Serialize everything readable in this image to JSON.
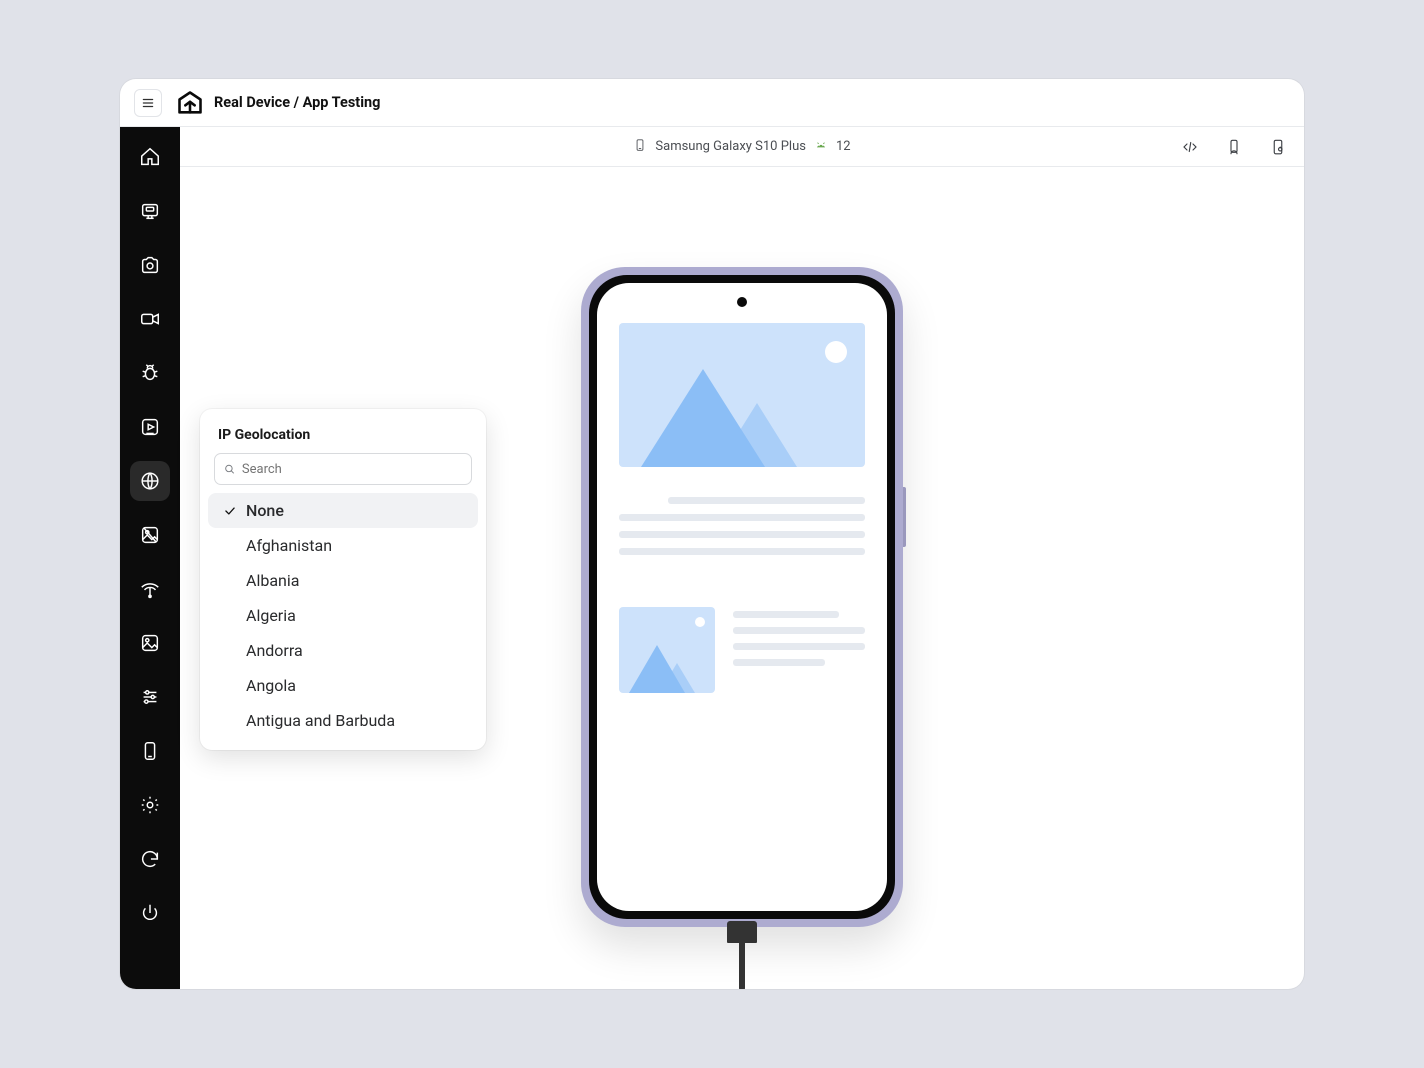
{
  "header": {
    "breadcrumb": "Real Device / App Testing"
  },
  "deviceBar": {
    "deviceName": "Samsung Galaxy S10 Plus",
    "osVersion": "12"
  },
  "sidebar": {
    "items": [
      {
        "name": "home-icon"
      },
      {
        "name": "app-icon"
      },
      {
        "name": "camera-icon"
      },
      {
        "name": "video-icon"
      },
      {
        "name": "bug-icon"
      },
      {
        "name": "record-icon"
      },
      {
        "name": "globe-icon",
        "active": true
      },
      {
        "name": "placeholder-icon"
      },
      {
        "name": "network-icon"
      },
      {
        "name": "image-icon"
      },
      {
        "name": "sliders-icon"
      },
      {
        "name": "device-icon"
      },
      {
        "name": "gear-icon"
      },
      {
        "name": "sync-icon"
      },
      {
        "name": "power-icon"
      }
    ]
  },
  "geolocation": {
    "title": "IP Geolocation",
    "searchPlaceholder": "Search",
    "items": [
      {
        "label": "None",
        "selected": true
      },
      {
        "label": "Afghanistan",
        "selected": false
      },
      {
        "label": "Albania",
        "selected": false
      },
      {
        "label": "Algeria",
        "selected": false
      },
      {
        "label": "Andorra",
        "selected": false
      },
      {
        "label": "Angola",
        "selected": false
      },
      {
        "label": "Antigua and Barbuda",
        "selected": false
      }
    ]
  }
}
